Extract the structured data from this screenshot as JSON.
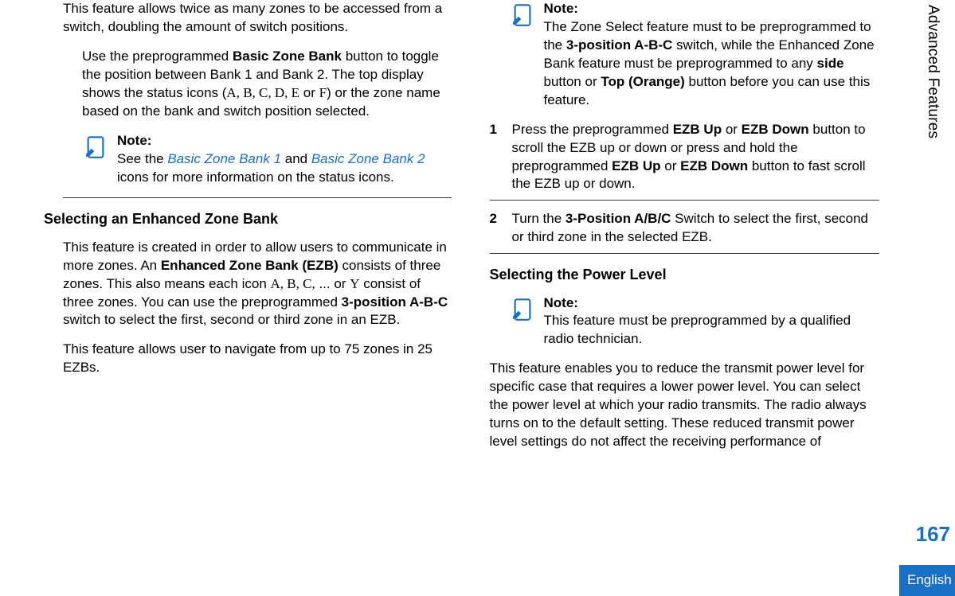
{
  "sidebar": {
    "section": "Advanced Features",
    "pageNumber": "167",
    "language": "English"
  },
  "left": {
    "intro": "This feature allows twice as many zones to be accessed from a switch, doubling the amount of switch positions.",
    "basic_p1": "Use the preprogrammed ",
    "basic_b1": "Basic Zone Bank",
    "basic_p2": " button to toggle the position between Bank 1 and Bank 2. The top display shows the status icons (",
    "basic_s_letters": "A, B, C, D, E",
    "basic_p3": " or ",
    "basic_s_f": "F",
    "basic_p4": ") or the zone name based on the bank and switch position selected.",
    "note1_title": "Note:",
    "note1_p1": "See the ",
    "note1_link1": "Basic Zone Bank 1",
    "note1_mid": " and ",
    "note1_link2": "Basic Zone Bank 2",
    "note1_p2": " icons for more information on the status icons.",
    "h1": "Selecting an Enhanced Zone Bank",
    "ezb_p1a": "This feature is created in order to allow users to communicate in more zones. An ",
    "ezb_b1": "Enhanced Zone Bank (EZB)",
    "ezb_p1b": " consists of three zones. This also means each icon ",
    "ezb_letters1": "A, B, C,",
    "ezb_dots": " ... or ",
    "ezb_y": "Y",
    "ezb_p1c": " consist of three zones. You can use the preprogrammed ",
    "ezb_b2": "3-position A-B-C",
    "ezb_p1d": " switch to select the first, second or third zone in an EZB.",
    "ezb_p2": "This feature allows user to navigate from up to 75 zones in 25 EZBs."
  },
  "right": {
    "note2_title": "Note:",
    "note2_p1": "The Zone Select feature must to be preprogrammed to the ",
    "note2_b1": "3-position A-B-C",
    "note2_p2": " switch, while the Enhanced Zone Bank feature must be preprogrammed to any ",
    "note2_b2": "side",
    "note2_p3": " button or ",
    "note2_b3": "Top (Orange)",
    "note2_p4": " button before you can use this feature.",
    "step1_n": "1",
    "step1_a": "Press the preprogrammed ",
    "step1_b1": "EZB Up",
    "step1_mid1": " or ",
    "step1_b2": "EZB Down",
    "step1_c": " button to scroll the EZB up or down or press and hold the preprogrammed ",
    "step1_b3": "EZB Up",
    "step1_mid2": " or ",
    "step1_b4": "EZB Down",
    "step1_d": " button to fast scroll the EZB up or down.",
    "step2_n": "2",
    "step2_a": "Turn the ",
    "step2_b1": "3-Position A/B/C",
    "step2_c": " Switch to select the first, second or third zone in the selected EZB.",
    "h2": "Selecting the Power Level",
    "note3_title": "Note:",
    "note3_text": "This feature must be preprogrammed by a qualified radio technician.",
    "power_p": "This feature enables you to reduce the transmit power level for specific case that requires a lower power level. You can select the power level at which your radio transmits. The radio always turns on to the default setting. These reduced transmit power level settings do not affect the receiving performance of"
  }
}
